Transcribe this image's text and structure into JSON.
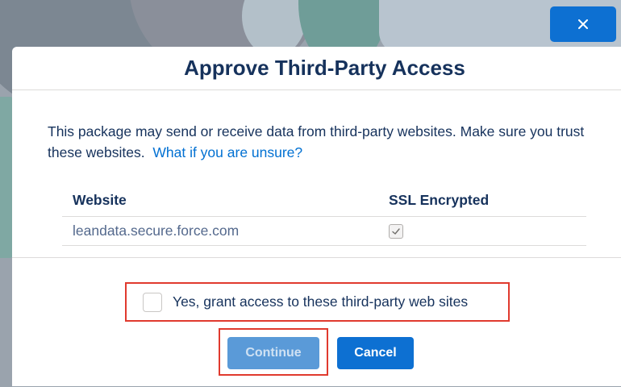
{
  "dialog": {
    "title": "Approve Third-Party Access",
    "description": "This package may send or receive data from third-party websites. Make sure you trust these websites.",
    "help_link": "What if you are unsure?",
    "close_icon": "close-icon"
  },
  "table": {
    "headers": [
      "Website",
      "SSL Encrypted"
    ],
    "rows": [
      {
        "website": "leandata.secure.force.com",
        "ssl_encrypted": true
      }
    ]
  },
  "grant": {
    "label": "Yes, grant access to these third-party web sites",
    "checked": false
  },
  "buttons": {
    "continue_label": "Continue",
    "cancel_label": "Cancel"
  },
  "colors": {
    "primary": "#0d70d2",
    "highlight": "#e03a2e",
    "text": "#16325c"
  }
}
